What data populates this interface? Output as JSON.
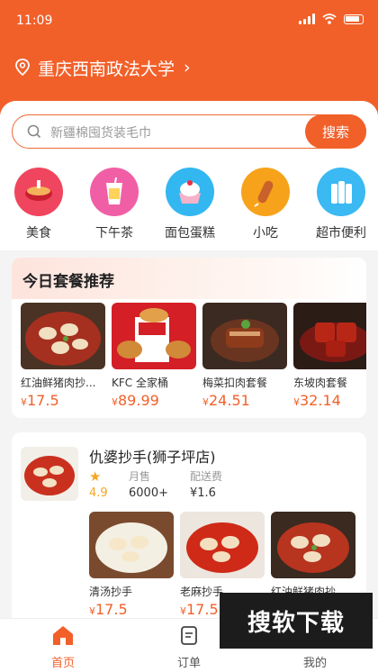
{
  "status": {
    "time": "11:09"
  },
  "location": {
    "name": "重庆西南政法大学"
  },
  "search": {
    "placeholder": "新疆棉囤货装毛巾",
    "button": "搜索"
  },
  "categories": [
    {
      "label": "美食",
      "icon": "hotpot-icon",
      "color": "#f0455e"
    },
    {
      "label": "下午茶",
      "icon": "drink-icon",
      "color": "#f05fa6"
    },
    {
      "label": "面包蛋糕",
      "icon": "cake-icon",
      "color": "#33b7f0"
    },
    {
      "label": "小吃",
      "icon": "snack-icon",
      "color": "#f7a21b"
    },
    {
      "label": "超市便利",
      "icon": "bottles-icon",
      "color": "#3ab9f2"
    }
  ],
  "combo": {
    "title": "今日套餐推荐",
    "items": [
      {
        "name": "红油鲜猪肉抄...",
        "price": "17.5",
        "currency": "¥"
      },
      {
        "name": "KFC 全家桶",
        "price": "89.99",
        "currency": "¥"
      },
      {
        "name": "梅菜扣肉套餐",
        "price": "24.51",
        "currency": "¥"
      },
      {
        "name": "东坡肉套餐",
        "price": "32.14",
        "currency": "¥"
      }
    ]
  },
  "shop": {
    "name": "仇婆抄手(狮子坪店)",
    "rating": "4.9",
    "sales_label": "月售",
    "sales": "6000+",
    "fee_label": "配送费",
    "fee": "¥1.6",
    "items": [
      {
        "name": "清汤抄手",
        "price": "17.5",
        "currency": "¥"
      },
      {
        "name": "老麻抄手",
        "price": "17.5",
        "currency": "¥"
      },
      {
        "name": "红油鲜猪肉抄...",
        "price": "",
        "currency": ""
      }
    ]
  },
  "tabs": [
    {
      "label": "首页",
      "icon": "home-icon"
    },
    {
      "label": "订单",
      "icon": "order-icon"
    },
    {
      "label": "我的",
      "icon": "user-icon"
    }
  ],
  "watermark": "搜软下载"
}
